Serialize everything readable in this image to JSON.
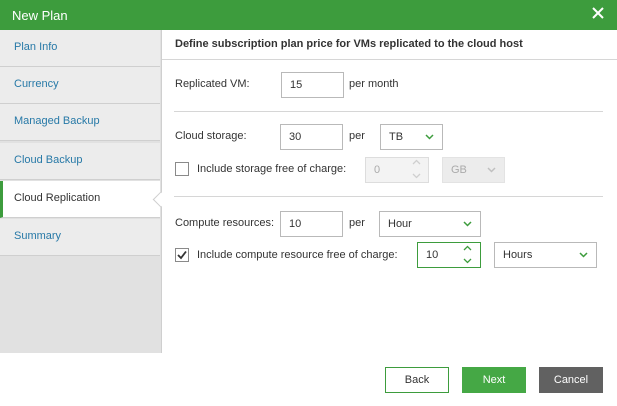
{
  "dialog": {
    "title": "New Plan"
  },
  "sidebar": {
    "items": [
      {
        "label": "Plan Info"
      },
      {
        "label": "Currency"
      },
      {
        "label": "Managed Backup"
      },
      {
        "label": "Cloud Backup"
      },
      {
        "label": "Cloud Replication"
      },
      {
        "label": "Summary"
      }
    ],
    "active_index": 4
  },
  "content": {
    "header": "Define subscription plan price for VMs replicated to the cloud host",
    "replicated_vm": {
      "label": "Replicated VM:",
      "value": "15",
      "suffix": "per month"
    },
    "cloud_storage": {
      "label": "Cloud storage:",
      "value": "30",
      "per": "per",
      "unit": "TB"
    },
    "storage_free": {
      "label": "Include storage free of charge:",
      "checked": false,
      "value": "0",
      "unit": "GB"
    },
    "compute": {
      "label": "Compute resources:",
      "value": "10",
      "per": "per",
      "unit": "Hour"
    },
    "compute_free": {
      "label": "Include compute resource free of charge:",
      "checked": true,
      "value": "10",
      "unit": "Hours"
    }
  },
  "footer": {
    "back": "Back",
    "next": "Next",
    "cancel": "Cancel"
  },
  "colors": {
    "accent": "#3d9c3d",
    "link": "#2779a7",
    "cancel_bg": "#616161"
  }
}
